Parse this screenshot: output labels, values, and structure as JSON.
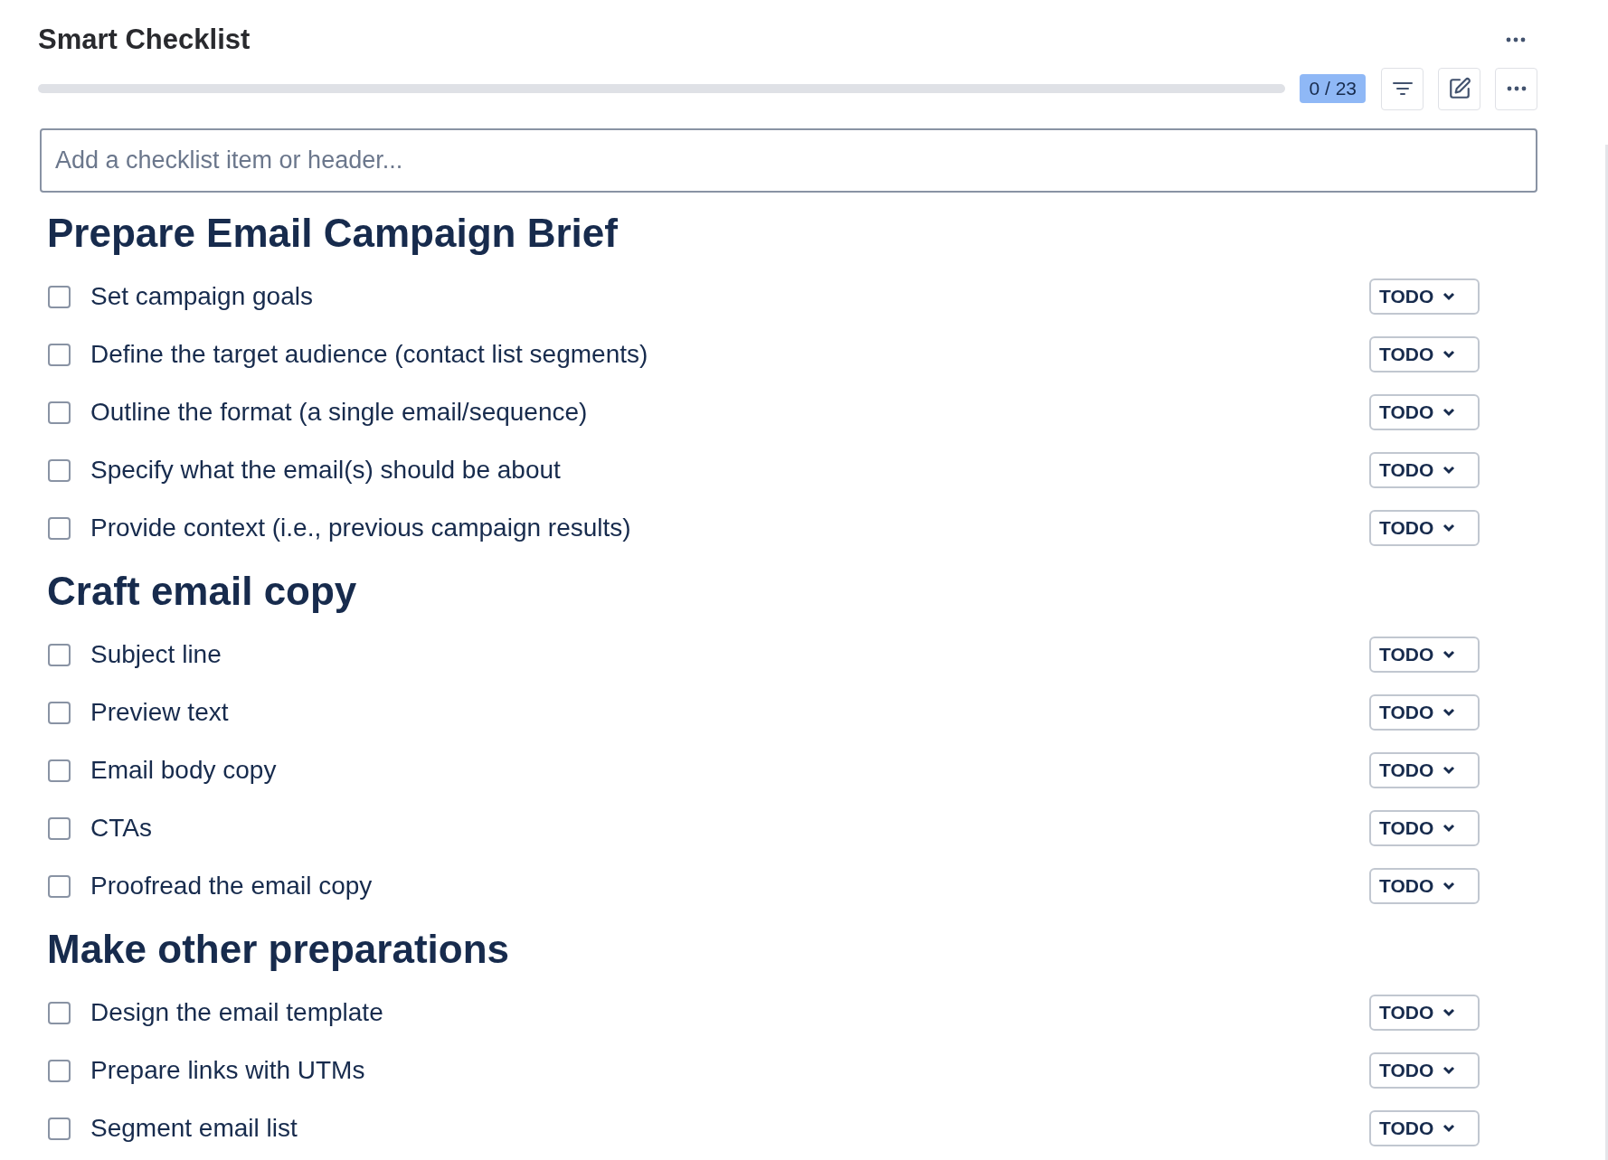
{
  "title": "Smart Checklist",
  "progress": {
    "level": 0,
    "count": "0 / 23"
  },
  "input": {
    "placeholder": "Add a checklist item or header..."
  },
  "sections": [
    {
      "header": "Prepare Email Campaign Brief",
      "items": [
        {
          "text": "Set campaign goals",
          "checked": false,
          "status": "TODO"
        },
        {
          "text": "Define the target audience (contact list segments)",
          "checked": false,
          "status": "TODO"
        },
        {
          "text": "Outline the format (a single email/sequence)",
          "checked": false,
          "status": "TODO"
        },
        {
          "text": "Specify what the email(s) should be about",
          "checked": false,
          "status": "TODO"
        },
        {
          "text": "Provide context (i.e., previous campaign results)",
          "checked": false,
          "status": "TODO"
        }
      ]
    },
    {
      "header": "Craft email copy",
      "items": [
        {
          "text": "Subject line",
          "checked": false,
          "status": "TODO"
        },
        {
          "text": "Preview text",
          "checked": false,
          "status": "TODO"
        },
        {
          "text": "Email body copy",
          "checked": false,
          "status": "TODO"
        },
        {
          "text": "CTAs",
          "checked": false,
          "status": "TODO"
        },
        {
          "text": "Proofread the email copy",
          "checked": false,
          "status": "TODO"
        }
      ]
    },
    {
      "header": "Make other preparations",
      "items": [
        {
          "text": "Design the email template",
          "checked": false,
          "status": "TODO"
        },
        {
          "text": "Prepare links with UTMs",
          "checked": false,
          "status": "TODO"
        },
        {
          "text": "Segment email list",
          "checked": false,
          "status": "TODO"
        }
      ]
    }
  ]
}
